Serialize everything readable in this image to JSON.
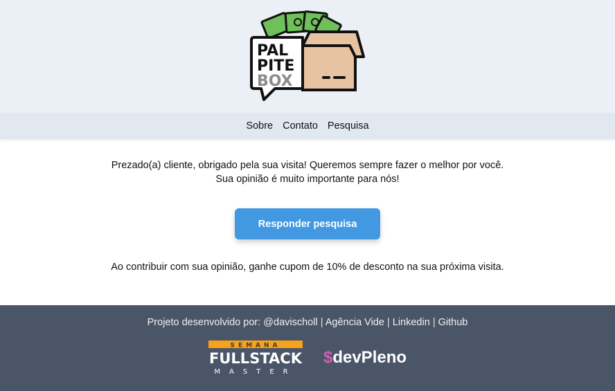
{
  "logo": {
    "line1": "PAL",
    "line2": "PITE",
    "line3": "BOX"
  },
  "nav": {
    "items": [
      "Sobre",
      "Contato",
      "Pesquisa"
    ]
  },
  "main": {
    "intro_line1": "Prezado(a) cliente, obrigado pela sua visita! Queremos sempre fazer o melhor por você.",
    "intro_line2": "Sua opinião é muito importante para nós!",
    "cta_label": "Responder pesquisa",
    "coupon_text": "Ao contribuir com sua opinião, ganhe cupom de 10% de desconto na sua próxima visita."
  },
  "footer": {
    "prefix": "Projeto desenvolvido por:",
    "author": "@davischoll",
    "agency": "Agência Vide",
    "linkedin": "Linkedin",
    "github": "Github",
    "separator": "|",
    "fsm_top": "SEMANA",
    "fsm_main": "FULLSTACK",
    "fsm_bottom": "MASTER",
    "devpleno_symbol": "$",
    "devpleno_name": "devPleno"
  },
  "colors": {
    "header_bg": "#ebf0f6",
    "nav_bg": "#e2e8f0",
    "button": "#4299e1",
    "footer_bg": "#4a5568",
    "fsm_orange": "#f7a21b",
    "devpleno_pink": "#d35db2"
  }
}
